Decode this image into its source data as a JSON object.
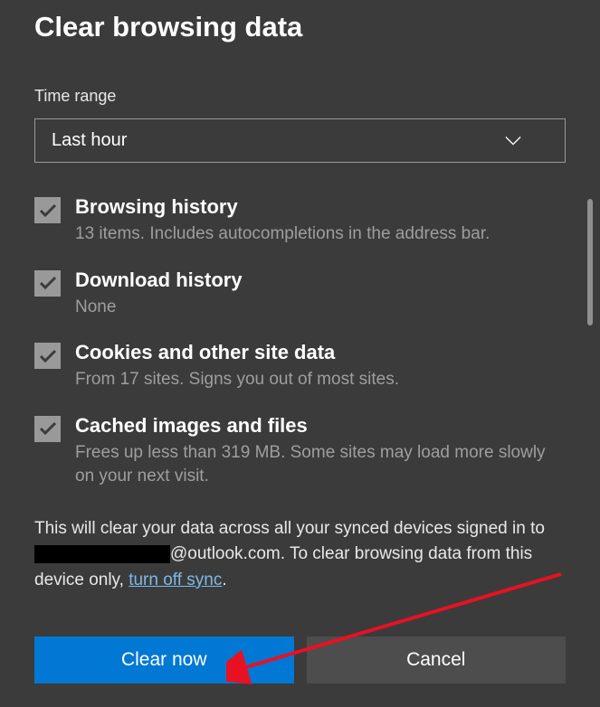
{
  "title": "Clear browsing data",
  "timeRange": {
    "label": "Time range",
    "selected": "Last hour"
  },
  "options": [
    {
      "id": "browsing-history",
      "title": "Browsing history",
      "desc": "13 items. Includes autocompletions in the address bar.",
      "checked": true
    },
    {
      "id": "download-history",
      "title": "Download history",
      "desc": "None",
      "checked": true
    },
    {
      "id": "cookies",
      "title": "Cookies and other site data",
      "desc": "From 17 sites. Signs you out of most sites.",
      "checked": true
    },
    {
      "id": "cached",
      "title": "Cached images and files",
      "desc": "Frees up less than 319 MB. Some sites may load more slowly on your next visit.",
      "checked": true
    }
  ],
  "syncNotice": {
    "pre": "This will clear your data across all your synced devices signed in to ",
    "emailSuffix": "@outlook.com. To clear browsing data from this device only, ",
    "linkText": "turn off sync",
    "post": "."
  },
  "buttons": {
    "clear": "Clear now",
    "cancel": "Cancel"
  }
}
